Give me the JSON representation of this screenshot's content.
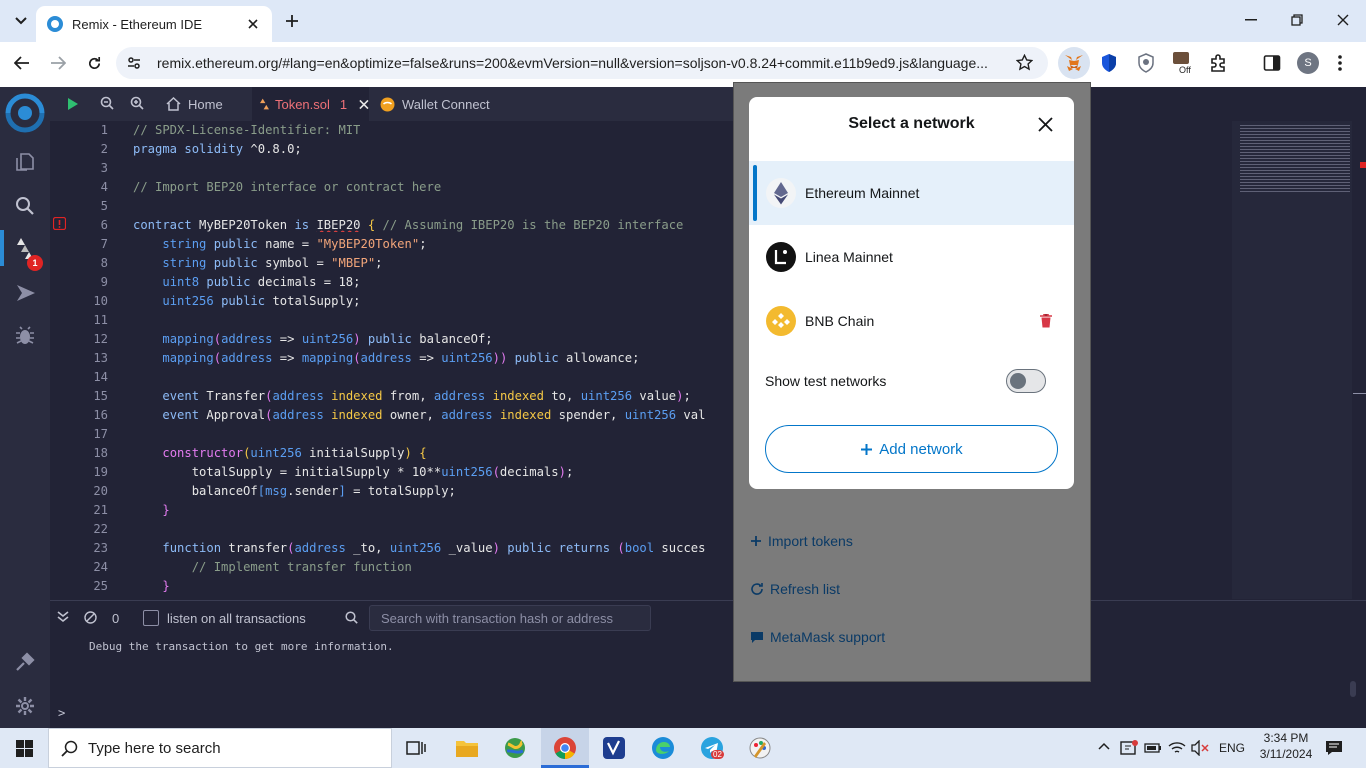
{
  "browser": {
    "tab_title": "Remix - Ethereum IDE",
    "url": "remix.ethereum.org/#lang=en&optimize=false&runs=200&evmVersion=null&version=soljson-v0.8.24+commit.e11b9ed9.js&language...",
    "profile_initial": "S",
    "ext_badge": "Off"
  },
  "remix": {
    "plugin_badge": "1",
    "tabs": [
      {
        "label": "Home"
      },
      {
        "label": "Token.sol",
        "badge": "1"
      },
      {
        "label": "Wallet Connect"
      }
    ]
  },
  "code_lines": [
    {
      "n": "1",
      "html": "<span class='cm'>// SPDX-License-Identifier: MIT</span>"
    },
    {
      "n": "2",
      "html": "<span class='kw'>pragma solidity</span> ^0.8.0;"
    },
    {
      "n": "3",
      "html": ""
    },
    {
      "n": "4",
      "html": "<span class='cm'>// Import BEP20 interface or contract here</span>"
    },
    {
      "n": "5",
      "html": ""
    },
    {
      "n": "6",
      "html": "<span class='kw'>contract</span> MyBEP20Token <span class='kw'>is</span> <span style='text-decoration:underline wavy #e04040'>IBEP20</span> <span class='ye'>{</span> <span class='cm'>// Assuming IBEP20 is the BEP20 interface</span>"
    },
    {
      "n": "7",
      "html": "    <span class='ty'>string</span> <span class='kw'>public</span> name = <span class='st'>\"MyBEP20Token\"</span>;"
    },
    {
      "n": "8",
      "html": "    <span class='ty'>string</span> <span class='kw'>public</span> symbol = <span class='st'>\"MBEP\"</span>;"
    },
    {
      "n": "9",
      "html": "    <span class='ty'>uint8</span> <span class='kw'>public</span> decimals = 18;"
    },
    {
      "n": "10",
      "html": "    <span class='ty'>uint256</span> <span class='kw'>public</span> totalSupply;"
    },
    {
      "n": "11",
      "html": ""
    },
    {
      "n": "12",
      "html": "    <span class='ty'>mapping</span><span class='pk'>(</span><span class='ty'>address</span> => <span class='ty'>uint256</span><span class='pk'>)</span> <span class='kw'>public</span> balanceOf;"
    },
    {
      "n": "13",
      "html": "    <span class='ty'>mapping</span><span class='pk'>(</span><span class='ty'>address</span> => <span class='ty'>mapping</span><span class='pk'>(</span><span class='ty'>address</span> => <span class='ty'>uint256</span><span class='pk'>))</span> <span class='kw'>public</span> allowance;"
    },
    {
      "n": "14",
      "html": ""
    },
    {
      "n": "15",
      "html": "    <span class='kw'>event</span> Transfer<span class='pk'>(</span><span class='ty'>address</span> <span class='ye'>indexed</span> from, <span class='ty'>address</span> <span class='ye'>indexed</span> to, <span class='ty'>uint256</span> value<span class='pk'>)</span>;"
    },
    {
      "n": "16",
      "html": "    <span class='kw'>event</span> Approval<span class='pk'>(</span><span class='ty'>address</span> <span class='ye'>indexed</span> owner, <span class='ty'>address</span> <span class='ye'>indexed</span> spender, <span class='ty'>uint256</span> val"
    },
    {
      "n": "17",
      "html": ""
    },
    {
      "n": "18",
      "html": "    <span class='pk'>constructor</span><span class='ye'>(</span><span class='ty'>uint256</span> initialSupply<span class='ye'>)</span> <span class='ye'>{</span>"
    },
    {
      "n": "19",
      "html": "        totalSupply = initialSupply * 10**<span class='ty'>uint256</span><span class='pk'>(</span>decimals<span class='pk'>)</span>;"
    },
    {
      "n": "20",
      "html": "        balanceOf<span class='ty'>[</span><span class='ty'>msg</span>.sender<span class='ty'>]</span> = totalSupply;"
    },
    {
      "n": "21",
      "html": "    <span class='pk'>}</span>"
    },
    {
      "n": "22",
      "html": ""
    },
    {
      "n": "23",
      "html": "    <span class='kw'>function</span> transfer<span class='pk'>(</span><span class='ty'>address</span> _to, <span class='ty'>uint256</span> _value<span class='pk'>)</span> <span class='kw'>public</span> <span class='kw'>returns</span> <span class='pk'>(</span><span class='ty'>bool</span> succes"
    },
    {
      "n": "24",
      "html": "        <span class='cm'>// Implement transfer function</span>"
    },
    {
      "n": "25",
      "html": "    <span class='pk'>}</span>"
    }
  ],
  "terminal": {
    "count": "0",
    "listen_label": "listen on all transactions",
    "search_placeholder": "Search with transaction hash or address",
    "message": "Debug the transaction to get more information.",
    "prompt": ">"
  },
  "metamask": {
    "title": "Select a network",
    "networks": [
      {
        "name": "Ethereum Mainnet",
        "selected": true
      },
      {
        "name": "Linea Mainnet",
        "selected": false
      },
      {
        "name": "BNB Chain",
        "selected": false
      }
    ],
    "show_test_label": "Show test networks",
    "show_test_value": false,
    "add_network": "Add network",
    "import_tokens": "Import tokens",
    "refresh_list": "Refresh list",
    "support": "MetaMask support",
    "accent": "#0376c9"
  },
  "taskbar": {
    "search_placeholder": "Type here to search",
    "telegram_badge": "02",
    "language": "ENG",
    "time": "3:34 PM",
    "date": "3/11/2024"
  }
}
